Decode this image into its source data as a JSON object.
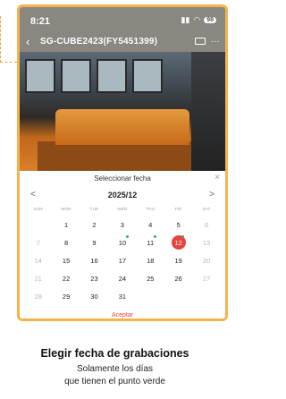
{
  "status_bar": {
    "time": "8:21",
    "battery": "98"
  },
  "nav": {
    "back_icon": "back-arrow-icon",
    "title": "SG-CUBE2423(FY5451399)",
    "more": "···"
  },
  "calendar": {
    "title": "Seleccionar fecha",
    "close": "×",
    "prev": "<",
    "next": ">",
    "month": "2025/12",
    "weekdays": [
      "SUN",
      "MON",
      "TUE",
      "WED",
      "THU",
      "FRI",
      "SAT"
    ],
    "weeks": [
      [
        {
          "d": "",
          "dim": false,
          "dot": false
        },
        {
          "d": "1",
          "dim": false,
          "dot": false
        },
        {
          "d": "2",
          "dim": false,
          "dot": false
        },
        {
          "d": "3",
          "dim": false,
          "dot": false
        },
        {
          "d": "4",
          "dim": false,
          "dot": false
        },
        {
          "d": "5",
          "dim": false,
          "dot": false
        },
        {
          "d": "6",
          "dim": true,
          "dot": false
        }
      ],
      [
        {
          "d": "7",
          "dim": true,
          "dot": false
        },
        {
          "d": "8",
          "dim": false,
          "dot": false
        },
        {
          "d": "9",
          "dim": false,
          "dot": false
        },
        {
          "d": "10",
          "dim": false,
          "dot": true
        },
        {
          "d": "11",
          "dim": false,
          "dot": true
        },
        {
          "d": "12",
          "dim": false,
          "dot": true,
          "selected": true
        },
        {
          "d": "13",
          "dim": true,
          "dot": false
        }
      ],
      [
        {
          "d": "14",
          "dim": true,
          "dot": false
        },
        {
          "d": "15",
          "dim": false,
          "dot": false
        },
        {
          "d": "16",
          "dim": false,
          "dot": false
        },
        {
          "d": "17",
          "dim": false,
          "dot": false
        },
        {
          "d": "18",
          "dim": false,
          "dot": false
        },
        {
          "d": "19",
          "dim": false,
          "dot": false
        },
        {
          "d": "20",
          "dim": true,
          "dot": false
        }
      ],
      [
        {
          "d": "21",
          "dim": true,
          "dot": false
        },
        {
          "d": "22",
          "dim": false,
          "dot": false
        },
        {
          "d": "23",
          "dim": false,
          "dot": false
        },
        {
          "d": "24",
          "dim": false,
          "dot": false
        },
        {
          "d": "25",
          "dim": false,
          "dot": false
        },
        {
          "d": "26",
          "dim": false,
          "dot": false
        },
        {
          "d": "27",
          "dim": true,
          "dot": false
        }
      ],
      [
        {
          "d": "28",
          "dim": true,
          "dot": false
        },
        {
          "d": "29",
          "dim": false,
          "dot": false
        },
        {
          "d": "30",
          "dim": false,
          "dot": false
        },
        {
          "d": "31",
          "dim": false,
          "dot": false
        },
        {
          "d": "",
          "dim": false,
          "dot": false
        },
        {
          "d": "",
          "dim": false,
          "dot": false
        },
        {
          "d": "",
          "dim": false,
          "dot": false
        }
      ]
    ],
    "accept": "Aceptar",
    "colors": {
      "selected": "#e8433f",
      "dot": "#2fb35b",
      "frame": "#f6b34c"
    }
  },
  "caption": {
    "title": "Elegir fecha de grabaciones",
    "line1": "Solamente los días",
    "line2": "que tienen el punto verde"
  }
}
